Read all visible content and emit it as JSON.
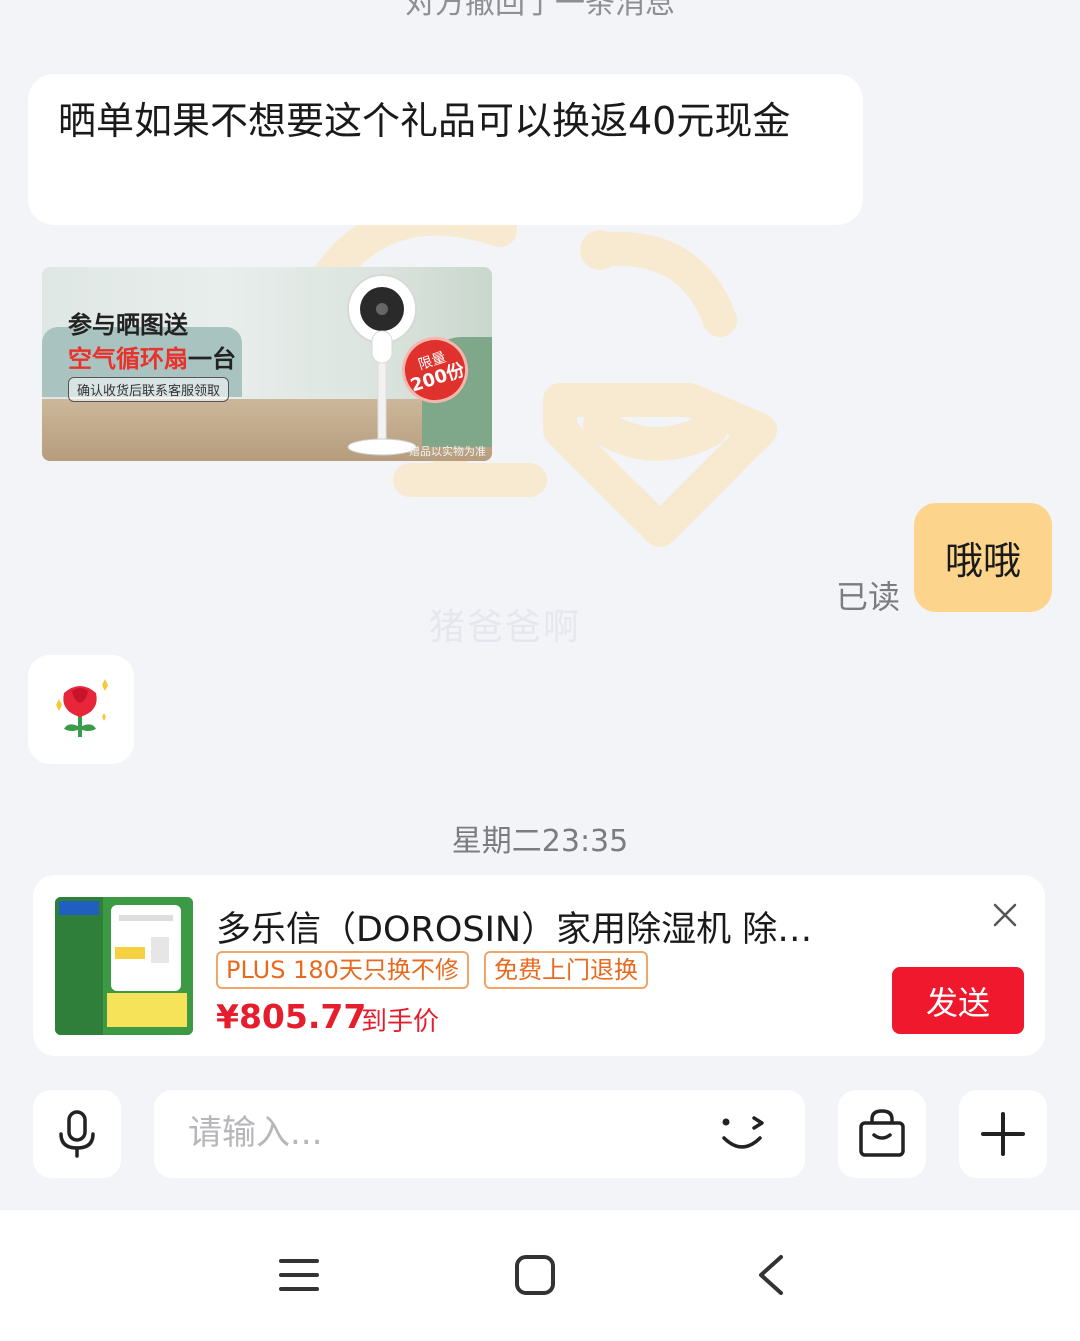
{
  "chat": {
    "recall_notice": "对方撤回了一条消息",
    "messages": {
      "m1_text": "晒单如果不想要这个礼品可以换返40元现金",
      "promo": {
        "line1": "参与晒图送",
        "line2_highlight": "空气循环扇",
        "line2_rest": "一台",
        "line3": "确认收货后联系客服领取",
        "badge_top": "限量",
        "badge_num": "200份",
        "note": "*赠品以实物为准"
      },
      "reply_text": "哦哦",
      "reply_status": "已读",
      "emoji_icon": "rose-emoji-icon"
    },
    "watermark": "猪爸爸啊",
    "timestamp": "星期二23:35"
  },
  "product_card": {
    "title": "多乐信（DOROSIN）家用除湿机 除…",
    "tags": [
      "PLUS 180天只换不修",
      "免费上门退换"
    ],
    "price": "¥805.77",
    "price_label": "到手价",
    "send_label": "发送"
  },
  "input_bar": {
    "placeholder": "请输入..."
  },
  "colors": {
    "background": "#f3f4f8",
    "my_bubble": "#fcd48b",
    "accent_red": "#f0182d",
    "tag_orange": "#e86a1f"
  }
}
